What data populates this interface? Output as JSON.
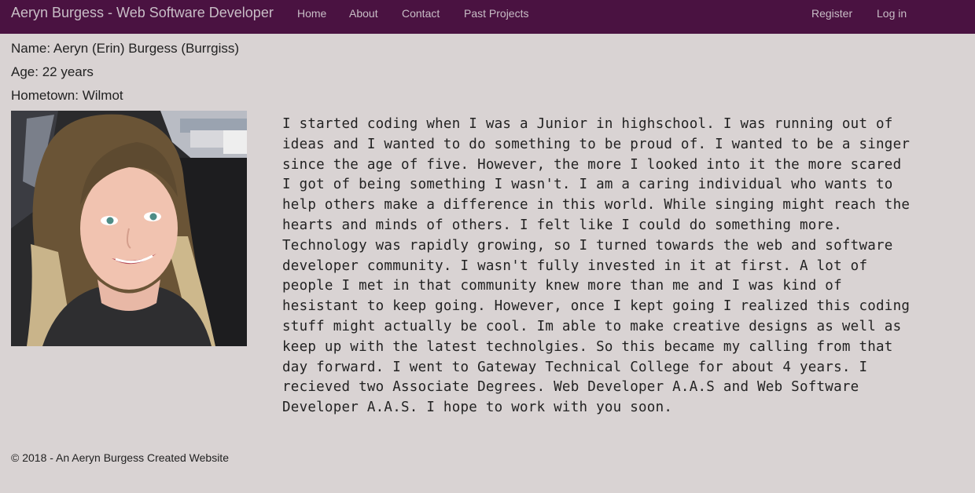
{
  "navbar": {
    "brand": "Aeryn Burgess - Web Software Developer",
    "links": [
      "Home",
      "About",
      "Contact",
      "Past Projects"
    ],
    "auth": [
      "Register",
      "Log in"
    ],
    "background": "#4a1241"
  },
  "profile": {
    "name": "Name: Aeryn (Erin) Burgess (Burrgiss)",
    "age": "Age: 22 years",
    "hometown": "Hometown: Wilmot",
    "photo": "profile-photo"
  },
  "bio": "I started coding when I was a Junior in highschool. I was running out of ideas and I wanted to do something to be proud of. I wanted to be a singer since the age of five. However, the more I looked into it the more scared I got of being something I wasn't. I am a caring individual who wants to help others make a difference in this world. While singing might reach the hearts and minds of others. I felt like I could do something more. Technology was rapidly growing, so I turned towards the web and software developer community. I wasn't fully invested in it at first. A lot of people I met in that community knew more than me and I was kind of hesistant to keep going. However, once I kept going I realized this coding stuff might actually be cool. Im able to make creative designs as well as keep up with the latest technolgies. So this became my calling from that day forward. I went to Gateway Technical College for about 4 years. I recieved two Associate Degrees. Web Developer A.A.S and Web Software Developer A.A.S. I hope to work with you soon.",
  "footer": "© 2018 - An Aeryn Burgess Created Website",
  "colors": {
    "page_background": "#d9d3d3",
    "nav_text": "#c8bdc6"
  }
}
